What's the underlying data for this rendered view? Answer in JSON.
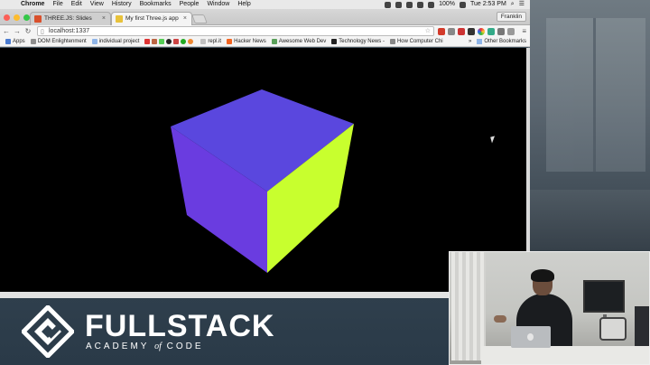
{
  "menubar": {
    "apple_glyph": "",
    "items": [
      "Chrome",
      "File",
      "Edit",
      "View",
      "History",
      "Bookmarks",
      "People",
      "Window",
      "Help"
    ],
    "battery": "100%",
    "clock": "Tue 2:53 PM"
  },
  "tabs": [
    {
      "label": "THREE.JS: Slides",
      "favicon_color": "#d9502c"
    },
    {
      "label": "My first Three.js app",
      "favicon_color": "#e8c23b"
    }
  ],
  "profile_name": "Franklin",
  "address_bar": {
    "url": "localhost:1337"
  },
  "bookmarks": {
    "items": [
      {
        "label": "Apps",
        "icon_color": "#4a7bd0"
      },
      {
        "label": "DOM Enlightenment",
        "icon_color": "#8e8e8e"
      },
      {
        "label": "individual project",
        "icon_color": "#8fb5e8"
      },
      {
        "label": "repl.it",
        "icon_color": "#c0c0c0"
      },
      {
        "label": "Hacker News",
        "icon_color": "#f26522"
      },
      {
        "label": "Awesome Web Dev",
        "icon_color": "#5aa05a"
      },
      {
        "label": "Technology News -",
        "icon_color": "#222222"
      },
      {
        "label": "How Computer Chi",
        "icon_color": "#888888"
      }
    ],
    "other": "Other Bookmarks"
  },
  "scene": {
    "background": "#000000",
    "cube_colors": {
      "top": "#5a47de",
      "left": "#6a3ce0",
      "right": "#c8ff2e"
    }
  },
  "brand": {
    "name": "FULLSTACK",
    "tagline_before": "ACADEMY",
    "tagline_of": "of",
    "tagline_after": "CODE"
  },
  "colors": {
    "accent": "#2e3f4d",
    "logo": "#ffffff"
  }
}
